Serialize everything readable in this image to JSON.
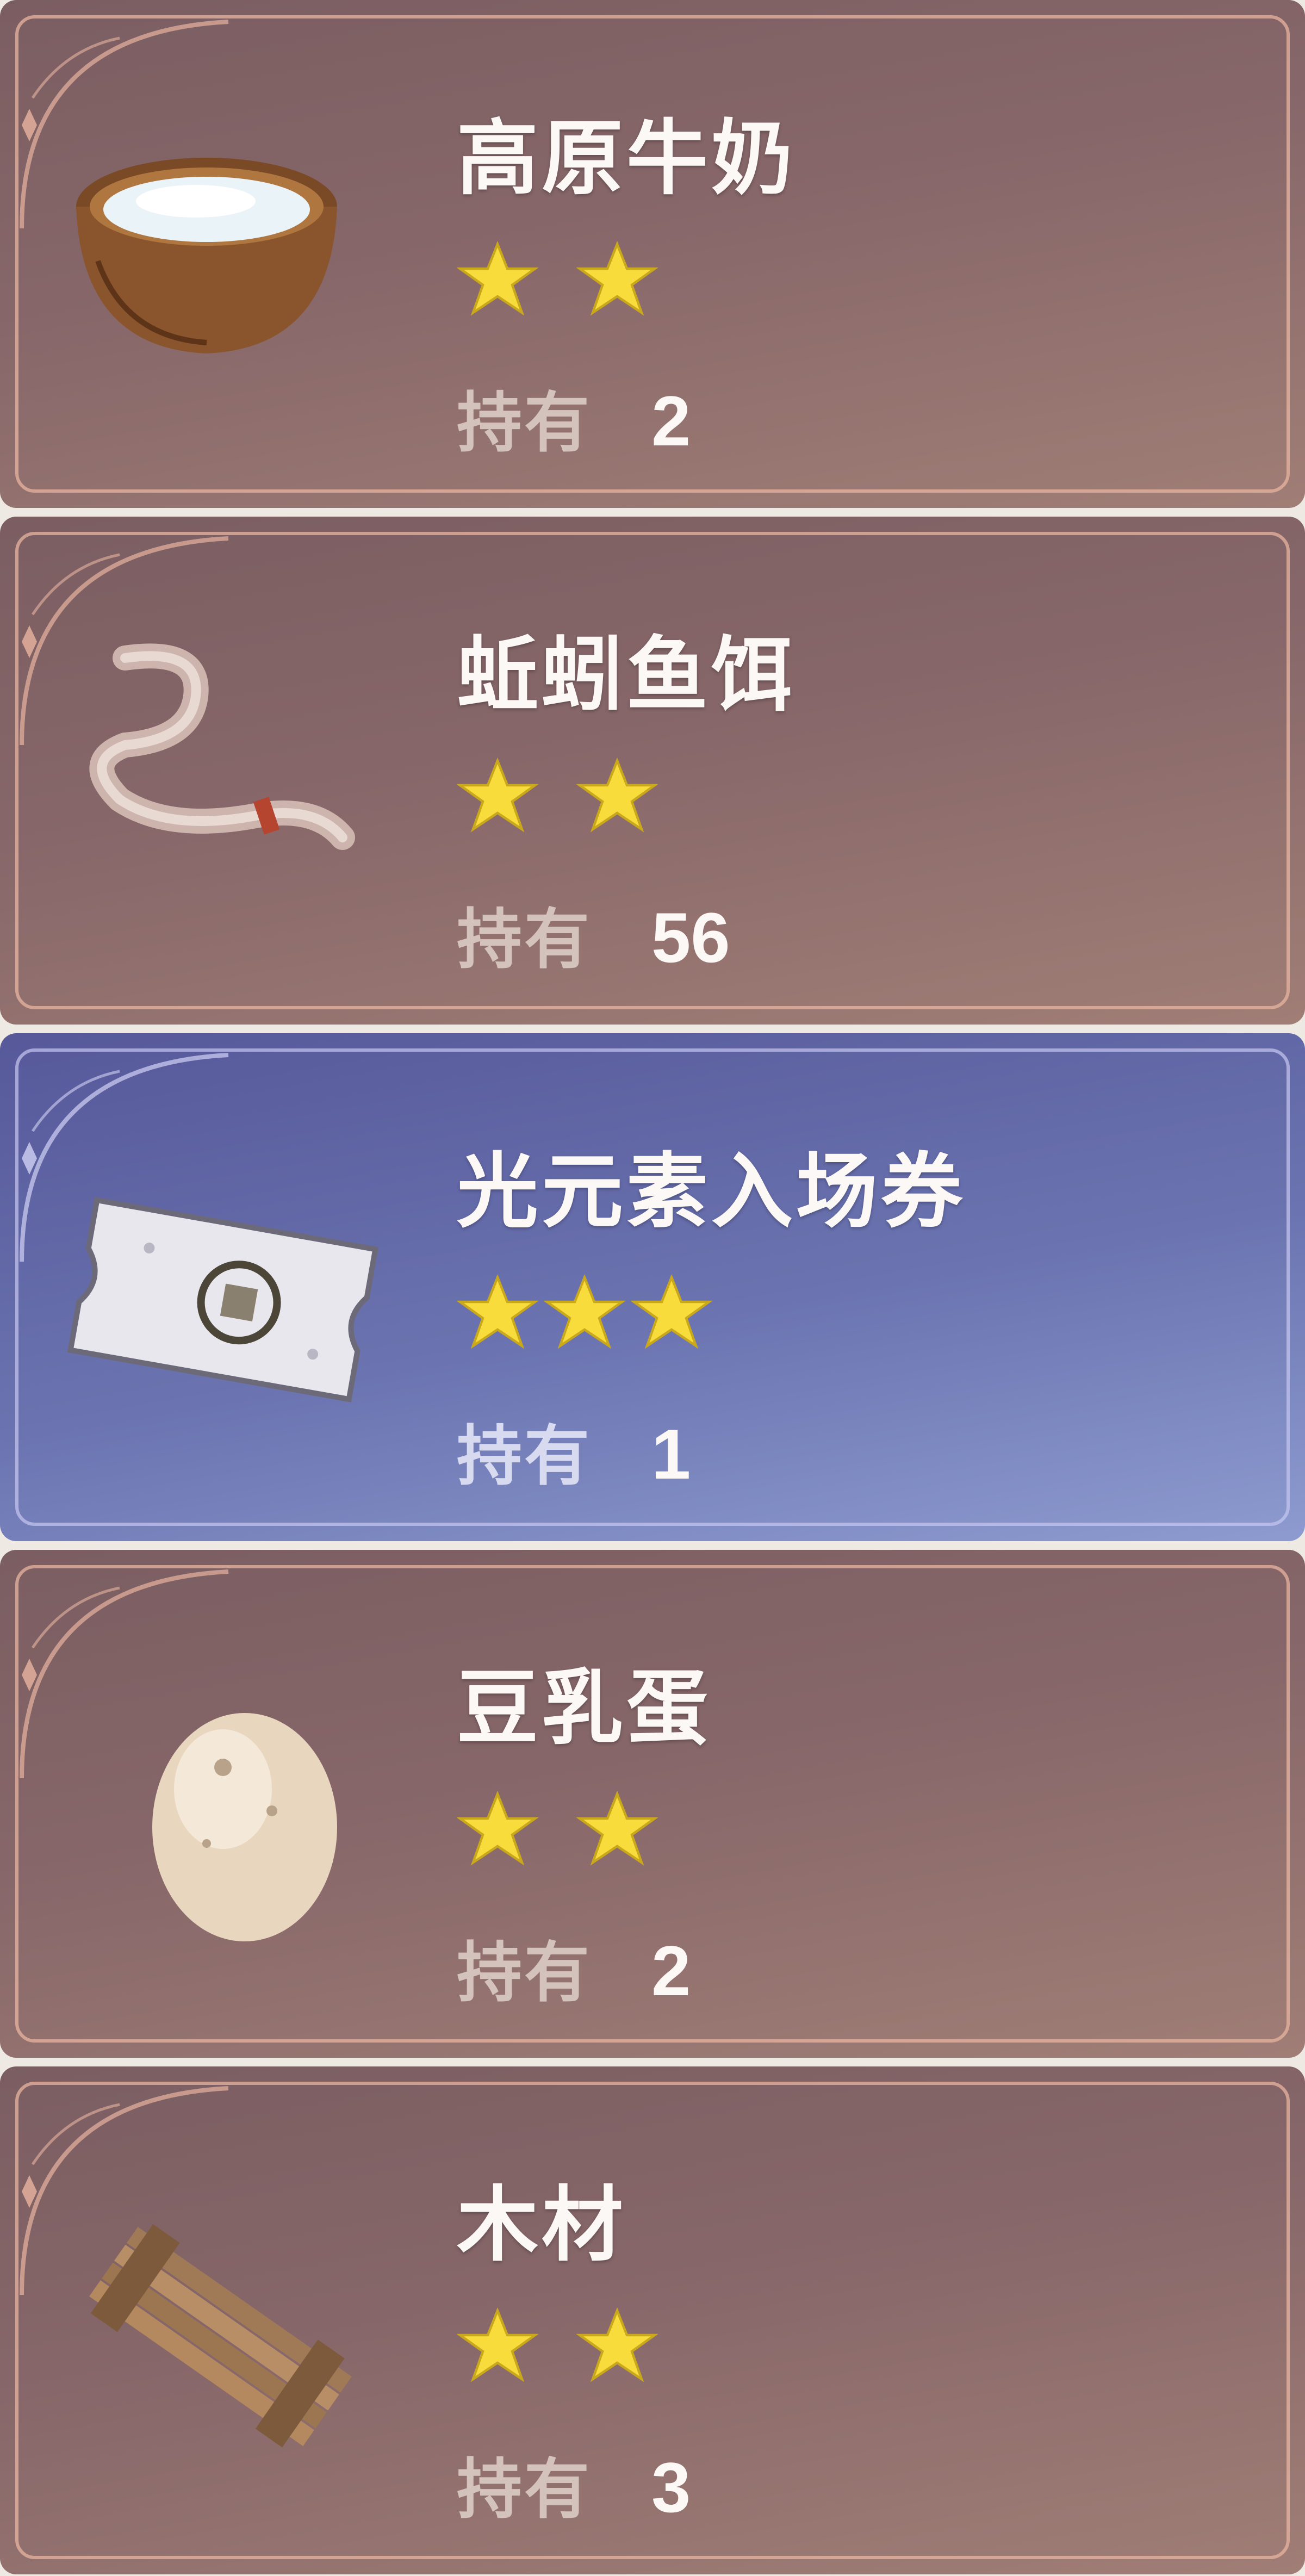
{
  "items": [
    {
      "name": "高原牛奶",
      "rarity": 2,
      "owned_label": "持有",
      "owned_count": "2",
      "icon": "milk-bowl-icon",
      "theme": "brown"
    },
    {
      "name": "蚯蚓鱼饵",
      "rarity": 2,
      "owned_label": "持有",
      "owned_count": "56",
      "icon": "worm-bait-icon",
      "theme": "brown"
    },
    {
      "name": "光元素入场券",
      "rarity": 3,
      "owned_label": "持有",
      "owned_count": "1",
      "icon": "ticket-icon",
      "theme": "blue"
    },
    {
      "name": "豆乳蛋",
      "rarity": 2,
      "owned_label": "持有",
      "owned_count": "2",
      "icon": "egg-icon",
      "theme": "brown"
    },
    {
      "name": "木材",
      "rarity": 2,
      "owned_label": "持有",
      "owned_count": "3",
      "icon": "wood-planks-icon",
      "theme": "brown"
    }
  ],
  "colors": {
    "brown_card": "#876769",
    "blue_card": "#6b74b0",
    "star": "#f7dc3c",
    "text": "#fbf8f6"
  }
}
